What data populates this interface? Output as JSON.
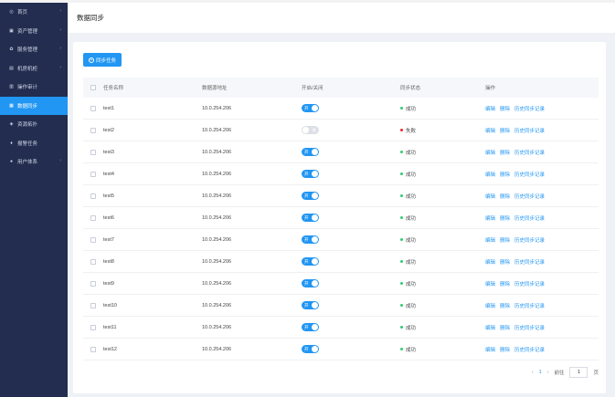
{
  "sidebar": {
    "items": [
      {
        "label": "首页",
        "icon": "dashboard-icon",
        "glyph": "◎",
        "arrow": true
      },
      {
        "label": "资产管理",
        "icon": "asset-icon",
        "glyph": "▣",
        "arrow": true
      },
      {
        "label": "服务管理",
        "icon": "service-icon",
        "glyph": "✿",
        "arrow": true
      },
      {
        "label": "机房机柜",
        "icon": "server-icon",
        "glyph": "▤",
        "arrow": true
      },
      {
        "label": "操作审计",
        "icon": "audit-icon",
        "glyph": "▥",
        "arrow": false
      },
      {
        "label": "数据同步",
        "icon": "sync-icon",
        "glyph": "▦",
        "arrow": false,
        "active": true
      },
      {
        "label": "资源拓扑",
        "icon": "topology-icon",
        "glyph": "◈",
        "arrow": false
      },
      {
        "label": "报警任务",
        "icon": "alarm-icon",
        "glyph": "♦",
        "arrow": false
      },
      {
        "label": "用户体系",
        "icon": "user-icon",
        "glyph": "●",
        "arrow": true
      }
    ]
  },
  "header": {
    "title": "数据同步"
  },
  "toolbar": {
    "add_label": "同步任务"
  },
  "table": {
    "columns": [
      "任务名称",
      "数据源地址",
      "开启/关闭",
      "同步状态",
      "操作"
    ],
    "rows": [
      {
        "name": "test1",
        "address": "10.0.254.206",
        "enabled": true,
        "status": "成功"
      },
      {
        "name": "test2",
        "address": "10.0.254.206",
        "enabled": false,
        "status": "失败"
      },
      {
        "name": "test3",
        "address": "10.0.254.206",
        "enabled": true,
        "status": "成功"
      },
      {
        "name": "test4",
        "address": "10.0.254.206",
        "enabled": true,
        "status": "成功"
      },
      {
        "name": "test5",
        "address": "10.0.254.206",
        "enabled": true,
        "status": "成功"
      },
      {
        "name": "test6",
        "address": "10.0.254.206",
        "enabled": true,
        "status": "成功"
      },
      {
        "name": "test7",
        "address": "10.0.254.206",
        "enabled": true,
        "status": "成功"
      },
      {
        "name": "test8",
        "address": "10.0.254.206",
        "enabled": true,
        "status": "成功"
      },
      {
        "name": "test9",
        "address": "10.0.254.206",
        "enabled": true,
        "status": "成功"
      },
      {
        "name": "test10",
        "address": "10.0.254.206",
        "enabled": true,
        "status": "成功"
      },
      {
        "name": "test11",
        "address": "10.0.254.206",
        "enabled": true,
        "status": "成功"
      },
      {
        "name": "test12",
        "address": "10.0.254.206",
        "enabled": true,
        "status": "成功"
      }
    ],
    "toggle_on_label": "开",
    "toggle_off_label": "关",
    "actions": [
      "编辑",
      "删除",
      "历史同步记录"
    ]
  },
  "pagination": {
    "prev": "‹",
    "current": "1",
    "next": "›",
    "goto_label": "前往",
    "page_value": "1",
    "page_suffix": "页"
  },
  "colors": {
    "accent": "#2196f3",
    "sidebar_bg": "#222d4f",
    "success": "#2ecc71",
    "fail": "#f5222d"
  }
}
